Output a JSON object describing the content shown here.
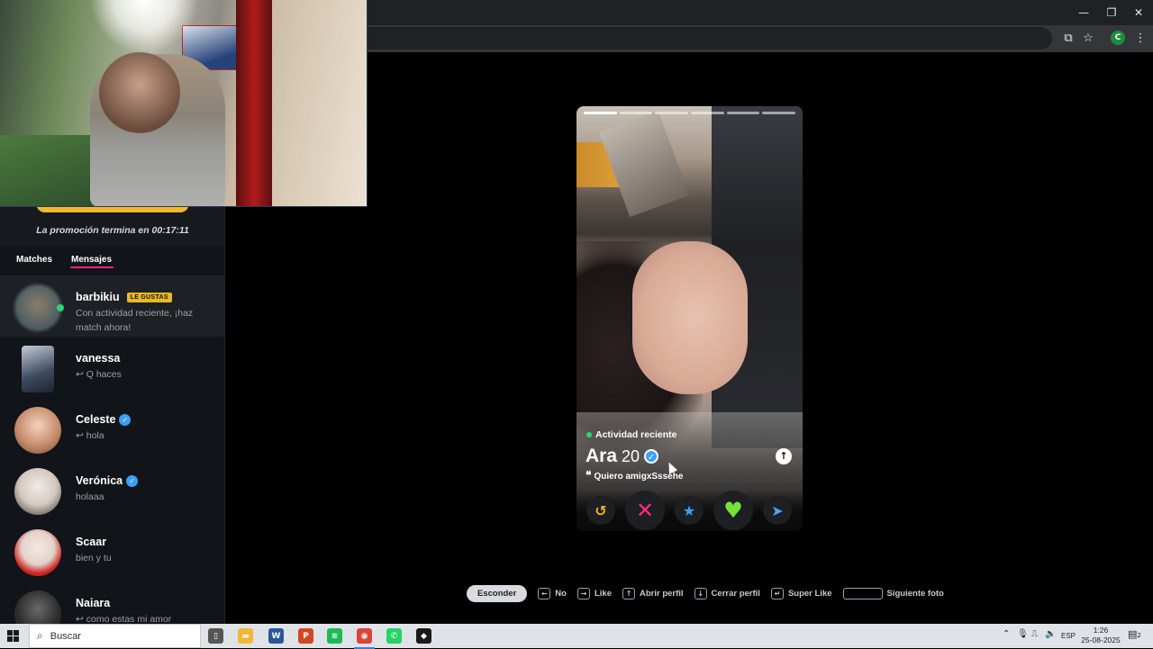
{
  "browser": {
    "window_controls": {
      "minimize": "—",
      "maximize": "❐",
      "close": "✕"
    },
    "toolbar_icons": [
      "install-app-icon",
      "bookmark-star-icon",
      "profile-icon",
      "menu-dots-icon"
    ],
    "profile_initial": "C"
  },
  "sidebar": {
    "promo_text": "La promoción termina en 00:17:11",
    "tabs": [
      {
        "label": "Matches",
        "active": false
      },
      {
        "label": "Mensajes",
        "active": true
      }
    ],
    "messages": [
      {
        "name": "barbikiu",
        "badge": "LE GUSTAS",
        "text": "Con actividad reciente, ¡haz match ahora!",
        "online": true,
        "verified": false,
        "highlight": true
      },
      {
        "name": "vanessa",
        "text": "Q haces",
        "reply_icon": "↩",
        "verified": false
      },
      {
        "name": "Celeste",
        "text": "hola",
        "reply_icon": "↩",
        "verified": true
      },
      {
        "name": "Verónica",
        "text": "holaaa",
        "verified": true
      },
      {
        "name": "Scaar",
        "text": "bien y tu",
        "verified": false
      },
      {
        "name": "Naiara",
        "text": "como estas mi amor",
        "reply_icon": "↩",
        "verified": false
      }
    ]
  },
  "profile": {
    "activity": "Actividad reciente",
    "name": "Ara",
    "age": "20",
    "bio": "Quiero amigxSssehe",
    "photo_count": 6,
    "active_photo": 1,
    "actions": [
      {
        "name": "rewind-button",
        "glyph": "↺",
        "color": "#f5b42a",
        "size": "sm"
      },
      {
        "name": "nope-button",
        "glyph": "✕",
        "color": "#fd2b7e",
        "size": "lg"
      },
      {
        "name": "super-like-button",
        "glyph": "★",
        "color": "#36a3ff",
        "size": "sm"
      },
      {
        "name": "like-button",
        "glyph": "♥",
        "color": "#73e33a",
        "size": "lg"
      },
      {
        "name": "boost-button",
        "glyph": "➤",
        "color": "#49a7ff",
        "size": "sm"
      }
    ]
  },
  "hints": {
    "hide_label": "Esconder",
    "items": [
      {
        "key": "←",
        "label": "No"
      },
      {
        "key": "→",
        "label": "Like"
      },
      {
        "key": "↑",
        "label": "Abrir perfil"
      },
      {
        "key": "↓",
        "label": "Cerrar perfil"
      },
      {
        "key": "↵",
        "label": "Super Like"
      },
      {
        "key": "",
        "label": "Siguiente foto",
        "space": true
      }
    ]
  },
  "taskbar": {
    "search_placeholder": "Buscar",
    "apps": [
      {
        "name": "task-view-icon",
        "glyph": "▯",
        "color": "#555555"
      },
      {
        "name": "file-explorer-icon",
        "glyph": "▬",
        "color": "#f2b736"
      },
      {
        "name": "word-icon",
        "glyph": "W",
        "color": "#2b579a"
      },
      {
        "name": "powerpoint-icon",
        "glyph": "P",
        "color": "#d24726"
      },
      {
        "name": "spotify-icon",
        "glyph": "≋",
        "color": "#1db954"
      },
      {
        "name": "chrome-icon",
        "glyph": "◉",
        "color": "#db4437",
        "active": true
      },
      {
        "name": "whatsapp-icon",
        "glyph": "✆",
        "color": "#25d366"
      },
      {
        "name": "roblox-icon",
        "glyph": "◆",
        "color": "#1a1a1a"
      }
    ],
    "language": "ESP",
    "time": "1:26",
    "date": "25-08-2025",
    "notifications": "2"
  }
}
